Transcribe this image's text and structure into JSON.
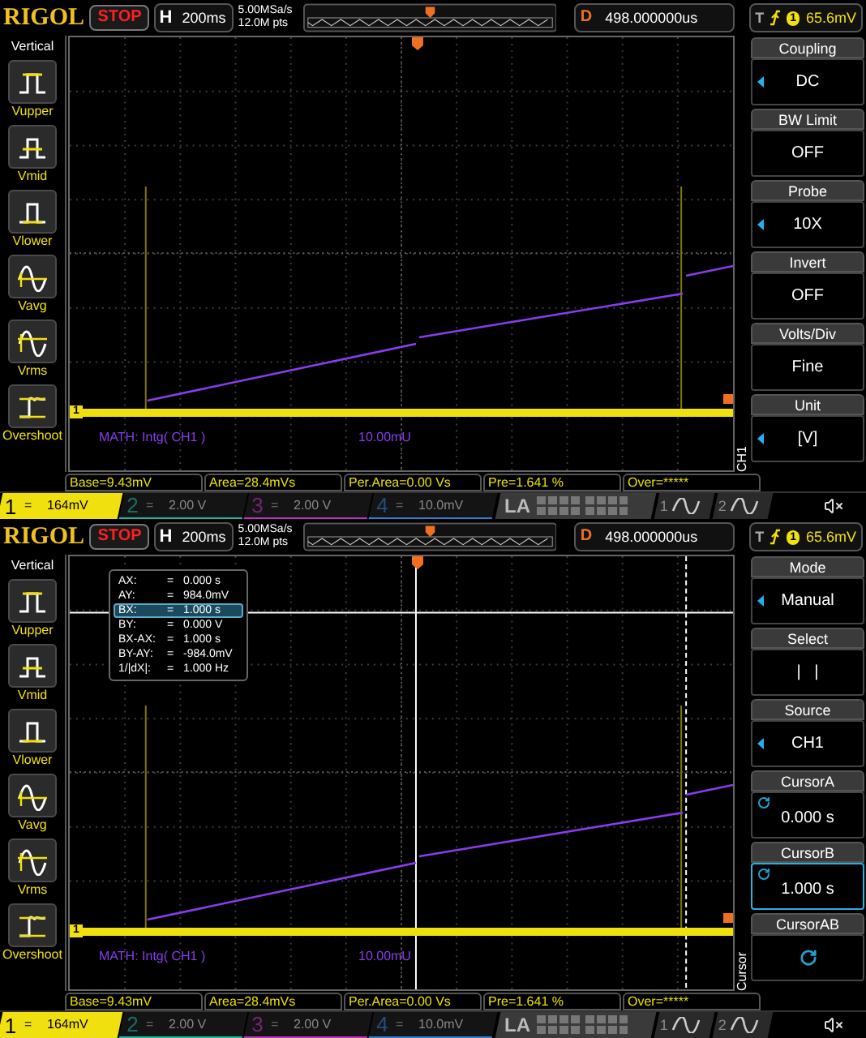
{
  "screens": [
    {
      "top": {
        "brand": "RIGOL",
        "run_state": "STOP",
        "timebase_label": "H",
        "timebase": "200ms",
        "sample_rate": "5.00MSa/s",
        "memory_depth": "12.0M pts",
        "delay_label": "D",
        "delay": "498.000000us",
        "trigger_label": "T",
        "trigger_source": "1",
        "trigger_level": "65.6mV"
      },
      "sidebar": {
        "title": "Vertical",
        "items": [
          {
            "label": "Vupper",
            "kind": "upper"
          },
          {
            "label": "Vmid",
            "kind": "mid"
          },
          {
            "label": "Vlower",
            "kind": "lower"
          },
          {
            "label": "Vavg",
            "kind": "avg"
          },
          {
            "label": "Vrms",
            "kind": "rms"
          },
          {
            "label": "Overshoot",
            "kind": "overshoot"
          }
        ]
      },
      "plot": {
        "channel_marker": "1",
        "math_label": "MATH: Intg( CH1 )",
        "math_scale": "10.00mU"
      },
      "menu": {
        "title": "CH1",
        "items": [
          {
            "label": "Coupling",
            "value": "DC",
            "kind": "list",
            "selected": false
          },
          {
            "label": "BW Limit",
            "value": "OFF",
            "kind": "plain",
            "selected": false
          },
          {
            "label": "Probe",
            "value": "10X",
            "kind": "list",
            "selected": false
          },
          {
            "label": "Invert",
            "value": "OFF",
            "kind": "plain",
            "selected": false
          },
          {
            "label": "Volts/Div",
            "value": "Fine",
            "kind": "plain",
            "selected": false
          },
          {
            "label": "Unit",
            "value": "[V]",
            "kind": "list",
            "selected": false
          }
        ]
      },
      "measurements": [
        "Base=9.43mV",
        "Area=28.4mVs",
        "Per.Area=0.00 Vs",
        "Pre=1.641 %",
        "Over=*****"
      ],
      "channels": [
        {
          "label": "1",
          "coupling": "=",
          "scale": "164mV",
          "on": true,
          "color": "#f0e010"
        },
        {
          "label": "2",
          "coupling": "=",
          "scale": "2.00 V",
          "on": false,
          "color": "#1fb5a8"
        },
        {
          "label": "3",
          "coupling": "=",
          "scale": "2.00 V",
          "on": false,
          "color": "#c030c0"
        },
        {
          "label": "4",
          "coupling": "=",
          "scale": "10.0mV",
          "on": false,
          "color": "#2f7fd0"
        }
      ],
      "logic_label": "LA",
      "generators": [
        "1",
        "2"
      ]
    },
    {
      "top": {
        "brand": "RIGOL",
        "run_state": "STOP",
        "timebase_label": "H",
        "timebase": "200ms",
        "sample_rate": "5.00MSa/s",
        "memory_depth": "12.0M pts",
        "delay_label": "D",
        "delay": "498.000000us",
        "trigger_label": "T",
        "trigger_source": "1",
        "trigger_level": "65.6mV"
      },
      "sidebar": {
        "title": "Vertical",
        "items": [
          {
            "label": "Vupper",
            "kind": "upper"
          },
          {
            "label": "Vmid",
            "kind": "mid"
          },
          {
            "label": "Vlower",
            "kind": "lower"
          },
          {
            "label": "Vavg",
            "kind": "avg"
          },
          {
            "label": "Vrms",
            "kind": "rms"
          },
          {
            "label": "Overshoot",
            "kind": "overshoot"
          }
        ]
      },
      "plot": {
        "channel_marker": "1",
        "math_label": "MATH: Intg( CH1 )",
        "math_scale": "10.00mU",
        "cursor_readout": [
          {
            "label": "AX:",
            "eq": "=",
            "value": "0.000 s",
            "selected": false
          },
          {
            "label": "AY:",
            "eq": "=",
            "value": "984.0mV",
            "selected": false
          },
          {
            "label": "BX:",
            "eq": "=",
            "value": "1.000 s",
            "selected": true
          },
          {
            "label": "BY:",
            "eq": "=",
            "value": "0.000 V",
            "selected": false
          },
          {
            "label": "BX-AX:",
            "eq": "=",
            "value": "1.000 s",
            "selected": false
          },
          {
            "label": "BY-AY:",
            "eq": "=",
            "value": "-984.0mV",
            "selected": false
          },
          {
            "label": "1/|dX|:",
            "eq": "=",
            "value": "1.000 Hz",
            "selected": false
          }
        ]
      },
      "menu": {
        "title": "Cursor",
        "items": [
          {
            "label": "Mode",
            "value": "Manual",
            "kind": "list",
            "selected": false
          },
          {
            "label": "Select",
            "value": "|   |",
            "kind": "plain",
            "selected": false
          },
          {
            "label": "Source",
            "value": "CH1",
            "kind": "list",
            "selected": false
          },
          {
            "label": "CursorA",
            "value": "0.000 s",
            "kind": "knob",
            "selected": false
          },
          {
            "label": "CursorB",
            "value": "1.000 s",
            "kind": "knob",
            "selected": true
          },
          {
            "label": "CursorAB",
            "kind": "knob",
            "selected": false
          }
        ]
      },
      "measurements": [
        "Base=9.43mV",
        "Area=28.4mVs",
        "Per.Area=0.00 Vs",
        "Pre=1.641 %",
        "Over=*****"
      ],
      "channels": [
        {
          "label": "1",
          "coupling": "=",
          "scale": "164mV",
          "on": true,
          "color": "#f0e010"
        },
        {
          "label": "2",
          "coupling": "=",
          "scale": "2.00 V",
          "on": false,
          "color": "#1fb5a8"
        },
        {
          "label": "3",
          "coupling": "=",
          "scale": "2.00 V",
          "on": false,
          "color": "#c030c0"
        },
        {
          "label": "4",
          "coupling": "=",
          "scale": "10.0mV",
          "on": false,
          "color": "#2f7fd0"
        }
      ],
      "logic_label": "LA",
      "generators": [
        "1",
        "2"
      ]
    }
  ]
}
